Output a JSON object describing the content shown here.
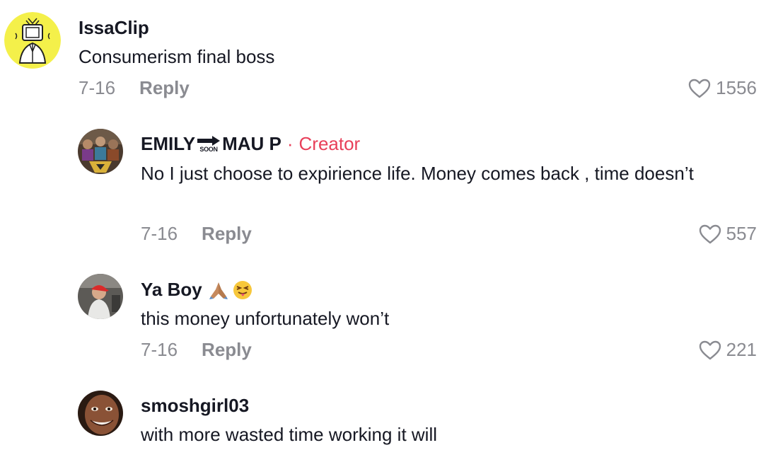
{
  "comments": [
    {
      "username": "IssaClip",
      "text": "Consumerism final boss",
      "date": "7-16",
      "reply_label": "Reply",
      "likes": "1556",
      "avatar_icon": "tv-head-avatar"
    },
    {
      "username_part1": "EMILY",
      "username_arrow_caption": "SOON",
      "username_part2": "MAU P",
      "creator_dot": "·",
      "creator_label": "Creator",
      "text": "No I just choose to expirience life. Money comes back , time doesn’t",
      "date": "7-16",
      "reply_label": "Reply",
      "likes": "557",
      "avatar_icon": "group-photo-avatar"
    },
    {
      "username": "Ya Boy",
      "username_emojis": [
        "folded-hands-emoji",
        "squinting-tongue-emoji"
      ],
      "text": "this money unfortunately won’t",
      "date": "7-16",
      "reply_label": "Reply",
      "likes": "221",
      "avatar_icon": "red-cap-person-avatar"
    },
    {
      "username": "smoshgirl03",
      "text": "with more wasted time working it will",
      "avatar_icon": "face-closeup-avatar"
    }
  ],
  "colors": {
    "primary_text": "#161823",
    "secondary_text": "#8a8b91",
    "creator_accent": "#e8405a",
    "avatar_yellow": "#f4f04a"
  }
}
